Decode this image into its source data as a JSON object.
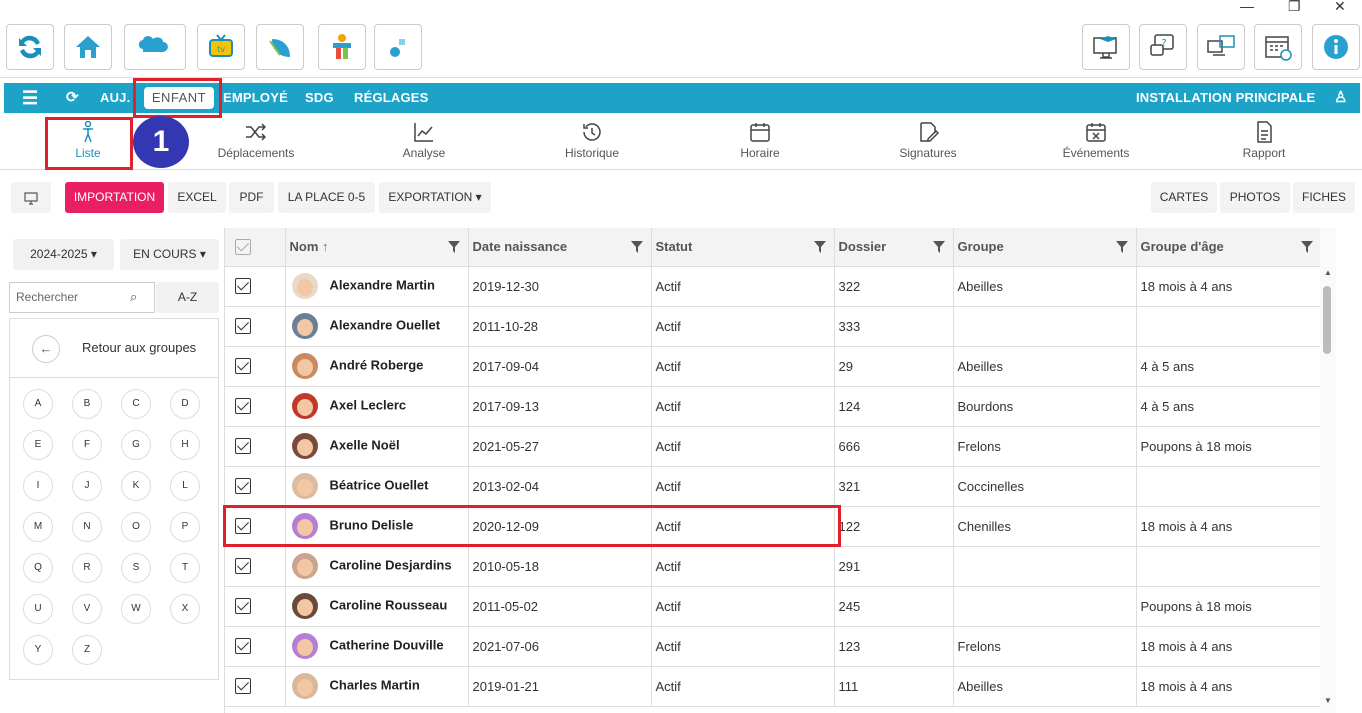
{
  "window": {
    "minimize": "—",
    "restore": "❐",
    "close": "✕"
  },
  "navbar": {
    "items": [
      "AUJ.",
      "ENFANT",
      "EMPLOYÉ",
      "SDG",
      "RÉGLAGES"
    ],
    "right_title": "INSTALLATION PRINCIPALE"
  },
  "subnav": [
    "Liste",
    "Déplacements",
    "Analyse",
    "Historique",
    "Horaire",
    "Signatures",
    "Événements",
    "Rapport"
  ],
  "step_badge": "1",
  "buttons": {
    "import": "IMPORTATION",
    "excel": "EXCEL",
    "pdf": "PDF",
    "laplace": "LA PLACE 0-5",
    "export": "EXPORTATION ▾",
    "cards": "CARTES",
    "photos": "PHOTOS",
    "sheets": "FICHES"
  },
  "left": {
    "year": "2024-2025 ▾",
    "status": "EN COURS ▾",
    "search_placeholder": "Rechercher",
    "az": "A-Z",
    "back": "Retour aux groupes",
    "letters": [
      "A",
      "B",
      "C",
      "D",
      "E",
      "F",
      "G",
      "H",
      "I",
      "J",
      "K",
      "L",
      "M",
      "N",
      "O",
      "P",
      "Q",
      "R",
      "S",
      "T",
      "U",
      "V",
      "W",
      "X",
      "Y",
      "Z"
    ]
  },
  "columns": [
    "Nom",
    "Date naissance",
    "Statut",
    "Dossier",
    "Groupe",
    "Groupe d'âge"
  ],
  "sort_arrow": "↑",
  "rows": [
    {
      "name": "Alexandre Martin",
      "dob": "2019-12-30",
      "status": "Actif",
      "file": "322",
      "group": "Abeilles",
      "age": "18 mois à 4 ans"
    },
    {
      "name": "Alexandre Ouellet",
      "dob": "2011-10-28",
      "status": "Actif",
      "file": "333",
      "group": "",
      "age": ""
    },
    {
      "name": "André Roberge",
      "dob": "2017-09-04",
      "status": "Actif",
      "file": "29",
      "group": "Abeilles",
      "age": "4 à 5 ans"
    },
    {
      "name": "Axel Leclerc",
      "dob": "2017-09-13",
      "status": "Actif",
      "file": "124",
      "group": "Bourdons",
      "age": "4 à 5 ans"
    },
    {
      "name": "Axelle Noël",
      "dob": "2021-05-27",
      "status": "Actif",
      "file": "666",
      "group": "Frelons",
      "age": "Poupons à 18 mois"
    },
    {
      "name": "Béatrice Ouellet",
      "dob": "2013-02-04",
      "status": "Actif",
      "file": "321",
      "group": "Coccinelles",
      "age": ""
    },
    {
      "name": "Bruno Delisle",
      "dob": "2020-12-09",
      "status": "Actif",
      "file": "122",
      "group": "Chenilles",
      "age": "18 mois à 4 ans"
    },
    {
      "name": "Caroline Desjardins",
      "dob": "2010-05-18",
      "status": "Actif",
      "file": "291",
      "group": "",
      "age": ""
    },
    {
      "name": "Caroline Rousseau",
      "dob": "2011-05-02",
      "status": "Actif",
      "file": "245",
      "group": "",
      "age": "Poupons à 18 mois"
    },
    {
      "name": "Catherine Douville",
      "dob": "2021-07-06",
      "status": "Actif",
      "file": "123",
      "group": "Frelons",
      "age": "18 mois à 4 ans"
    },
    {
      "name": "Charles Martin",
      "dob": "2019-01-21",
      "status": "Actif",
      "file": "111",
      "group": "Abeilles",
      "age": "18 mois à 4 ans"
    }
  ],
  "colors": {
    "accent": "#1da3c7",
    "primary": "#e91e63",
    "highlight": "#e0202a",
    "badge": "#3437b2"
  }
}
